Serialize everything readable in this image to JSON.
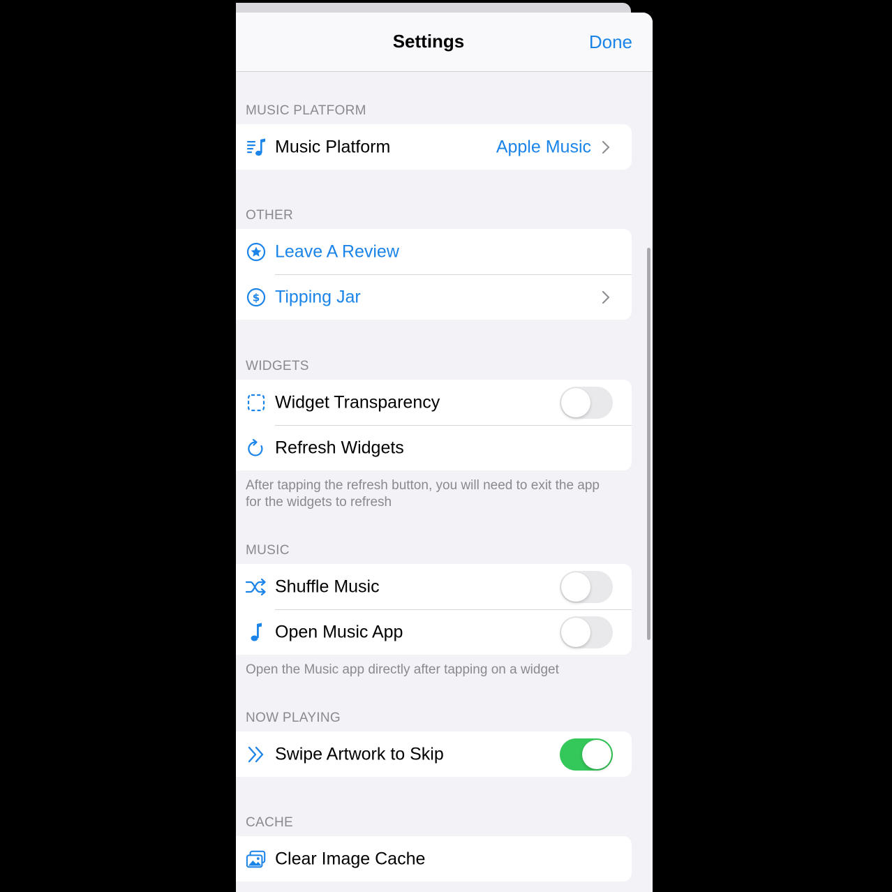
{
  "navbar": {
    "title": "Settings",
    "done_label": "Done"
  },
  "sections": {
    "music_platform": {
      "header": "MUSIC PLATFORM",
      "rows": [
        {
          "label": "Music Platform",
          "value": "Apple Music",
          "icon": "music-list-icon"
        }
      ]
    },
    "other": {
      "header": "OTHER",
      "rows": [
        {
          "label": "Leave A Review",
          "icon": "star-circle-icon"
        },
        {
          "label": "Tipping Jar",
          "icon": "dollar-circle-icon"
        }
      ]
    },
    "widgets": {
      "header": "WIDGETS",
      "rows": [
        {
          "label": "Widget Transparency",
          "icon": "dashed-square-icon",
          "toggle": false
        },
        {
          "label": "Refresh Widgets",
          "icon": "refresh-icon"
        }
      ],
      "footer": "After tapping the refresh button, you will need to exit the app for the widgets to refresh"
    },
    "music": {
      "header": "MUSIC",
      "rows": [
        {
          "label": "Shuffle Music",
          "icon": "shuffle-icon",
          "toggle": false
        },
        {
          "label": "Open Music App",
          "icon": "music-note-icon",
          "toggle": false
        }
      ],
      "footer": "Open the Music app directly after tapping on a widget"
    },
    "now_playing": {
      "header": "NOW PLAYING",
      "rows": [
        {
          "label": "Swipe Artwork to Skip",
          "icon": "double-chevron-right-icon",
          "toggle": true
        }
      ]
    },
    "cache": {
      "header": "CACHE",
      "rows": [
        {
          "label": "Clear Image Cache",
          "icon": "photos-icon"
        }
      ]
    }
  },
  "colors": {
    "accent": "#1a84e8",
    "toggle_on": "#34c759",
    "toggle_off": "#e9e9eb",
    "background": "#f2f2f7"
  }
}
